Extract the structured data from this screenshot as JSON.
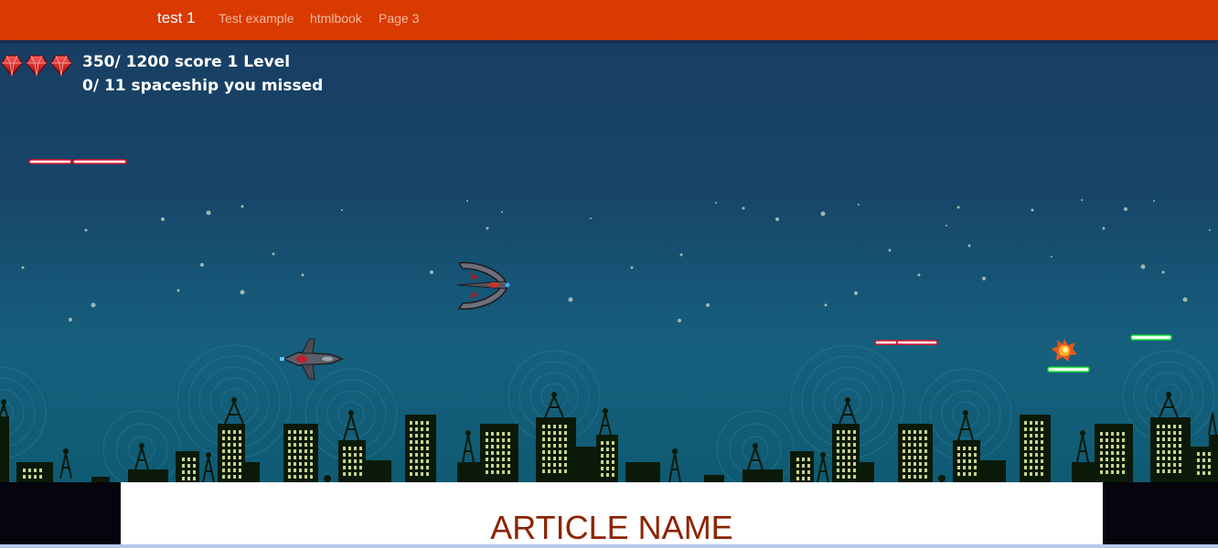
{
  "navbar": {
    "brand": "test 1",
    "links": [
      "Test example",
      "htmlbook",
      "Page 3"
    ],
    "color": "#d93a00"
  },
  "hud": {
    "lives": 3,
    "score_line": "350/ 1200 score 1 Level",
    "missed_line": "0/ 11 spaceship you missed",
    "life_icon": "red-gem-icon"
  },
  "game": {
    "sky_top_color": "#183e63",
    "sky_bottom_color": "#16607e",
    "player_ship_icon": "player-spaceship-icon",
    "enemy_ship_icon": "enemy-spaceship-icon",
    "explosion_icon": "explosion-icon"
  },
  "article": {
    "title": "ARTICLE NAME",
    "title_color": "#8c2400"
  }
}
